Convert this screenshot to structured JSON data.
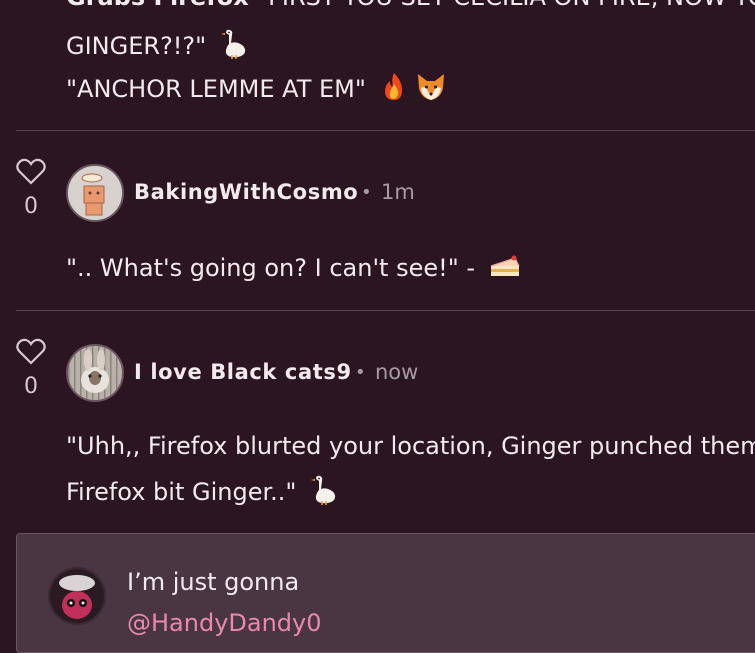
{
  "previous_comment": {
    "line1_bold": "Grabs Firefox",
    "line1_rest": "\"FIRST YOU SET CECILIA ON FIRE, NOW YOU",
    "line2": "GINGER?!?\"",
    "line2_emoji": "goose-icon",
    "line3": "\"ANCHOR LEMME AT EM\"",
    "line3_emojis": [
      "fire-icon",
      "fox-icon"
    ]
  },
  "comments": [
    {
      "username": "BakingWithCosmo",
      "time": "1m",
      "likes": "0",
      "text": "\".. What's going on? I can't see!\" -",
      "emoji": "cake-icon"
    },
    {
      "username": "I love Black cats9",
      "time": "now",
      "likes": "0",
      "text_line1": "\"Uhh,, Firefox blurted your location, Ginger punched them,",
      "text_line2": "Firefox bit Ginger..\"",
      "emoji": "goose-icon"
    }
  ],
  "reply": {
    "text": "I’m just gonna",
    "mention": "@HandyDandy0"
  },
  "colors": {
    "background": "#2b1521",
    "reply_background": "#4a3642",
    "mention": "#e88aa8"
  }
}
